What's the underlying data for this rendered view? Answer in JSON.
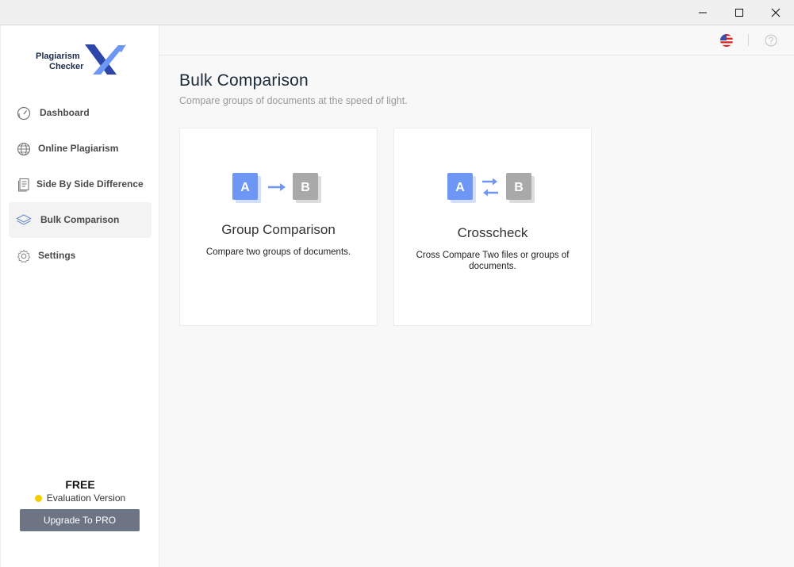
{
  "window": {
    "controls": {
      "minimize": "minimize-icon",
      "maximize": "maximize-icon",
      "close": "close-icon"
    }
  },
  "logo": {
    "line1": "Plagiarism",
    "line2": "Checker",
    "mark": "X"
  },
  "sidebar": {
    "items": [
      {
        "label": "Dashboard",
        "icon": "gauge-icon",
        "active": false
      },
      {
        "label": "Online Plagiarism",
        "icon": "globe-icon",
        "active": false
      },
      {
        "label": "Side By Side Difference",
        "icon": "document-icon",
        "active": false
      },
      {
        "label": "Bulk Comparison",
        "icon": "layers-icon",
        "active": true
      },
      {
        "label": "Settings",
        "icon": "gear-icon",
        "active": false
      }
    ]
  },
  "plan": {
    "title": "FREE",
    "subtitle": "Evaluation Version",
    "upgrade_label": "Upgrade To PRO",
    "dot_color": "#f5cc00"
  },
  "topbar": {
    "language_icon": "us-flag-icon",
    "help_icon": "help-icon"
  },
  "page": {
    "title": "Bulk Comparison",
    "subtitle": "Compare groups of documents at the speed of light."
  },
  "cards": [
    {
      "tile_a": "A",
      "tile_b": "B",
      "title": "Group Comparison",
      "description": "Compare two groups of documents."
    },
    {
      "tile_a": "A",
      "tile_b": "B",
      "title": "Crosscheck",
      "description": "Cross Compare Two files or groups of documents."
    }
  ],
  "colors": {
    "accent": "#6e97f5",
    "tile_grey": "#a9a9a9",
    "button": "#6d7585"
  }
}
